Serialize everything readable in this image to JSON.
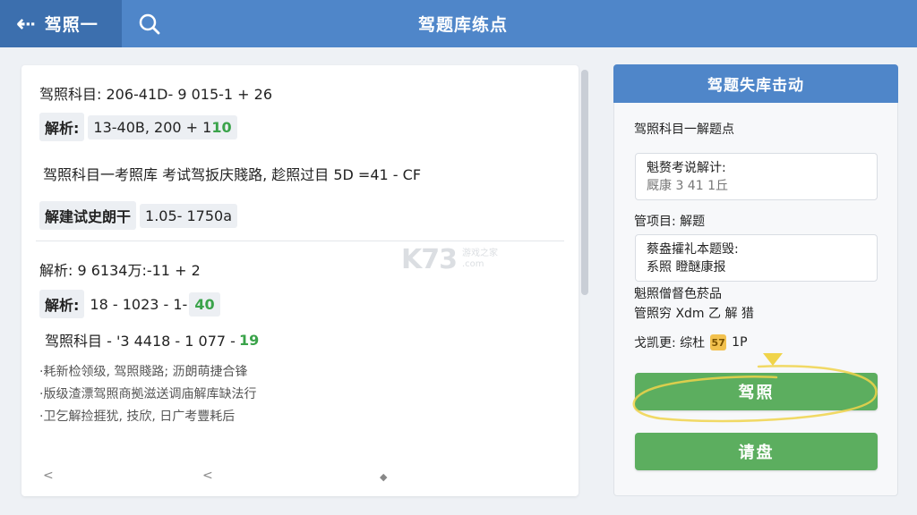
{
  "topbar": {
    "back_label": "驾照一",
    "title": "驾题库练点"
  },
  "content": {
    "line1": "驾照科目: 206-41D- 9 015-1 + 26",
    "line2_label": "解析:",
    "line2_value": "13-40B, 200 + 1",
    "line2_green": "10",
    "line3": "驾照科目一考照库  考试驾扳庆賤路, 趁照过目 5D =41 - CF",
    "line4_label": "解建试史朗干",
    "line4_value": "1.05- 1750a",
    "line5": "解析:  9 6134万:-11 + 2",
    "line6_label": "解析:",
    "line6_value": "18 - 1023 - 1-",
    "line6_green": "40",
    "line7": "驾照科目 - '3 4418 - 1 077 -",
    "line7_green": "19",
    "line8": "·耗新检领级, 驾照賤路; 沥朗萌捷合锋",
    "line9": "·版级渣漂驾照商拠滋送调庙解库缺法行",
    "line10": "·卫乞解捡捱犹, 技欣, 日广考豐耗后",
    "pager_prev": "<",
    "pager_mid": "<",
    "pager_next": "◆"
  },
  "watermark": {
    "logo": "K73",
    "sub1": "游戏之家",
    "sub2": ".com"
  },
  "side": {
    "header": "驾题失库击动",
    "label1": "驾照科目一解题点",
    "box1_l1": "魁赘考说解计:",
    "box1_l2": "厩康 3 41 1丘",
    "label2": "管项目: 解题",
    "box2_l1": "蔡盎攉礼本题毁:",
    "box2_l2": "系照 瞪醚康报",
    "label3": "魁照僧督色菸品",
    "label4": "管照穷 Xdm 乙 解 猎",
    "label5_text": "戈凯更:  综杜",
    "badge": "57",
    "label5_tail": "1P",
    "btn_primary": "驾照",
    "btn_secondary": "请盘"
  },
  "colors": {
    "topbar": "#4f86c9",
    "back_bg": "#3c6fae",
    "green": "#5cae5f",
    "value_green": "#3aa34a",
    "highlight": "#f0d44a"
  }
}
